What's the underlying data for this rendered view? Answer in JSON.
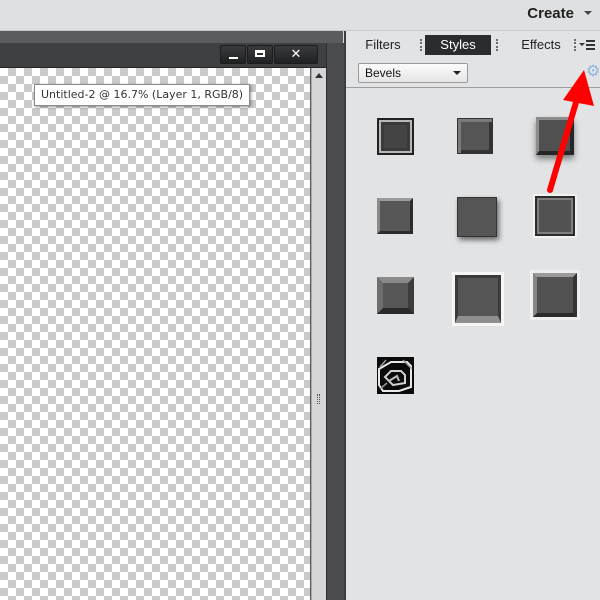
{
  "topbar": {
    "create_label": "Create"
  },
  "document": {
    "tooltip": "Untitled-2 @ 16.7% (Layer 1, RGB/8)"
  },
  "window_controls": {
    "close_glyph": "✕"
  },
  "panel": {
    "tabs": [
      {
        "label": "Filters",
        "active": false
      },
      {
        "label": "Styles",
        "active": true
      },
      {
        "label": "Effects",
        "active": false
      }
    ],
    "category_dropdown": {
      "selected": "Bevels"
    },
    "swatch_count": 10,
    "icons": {
      "gear": "⚙"
    }
  },
  "annotation": {
    "arrow_color": "#ff0000"
  }
}
